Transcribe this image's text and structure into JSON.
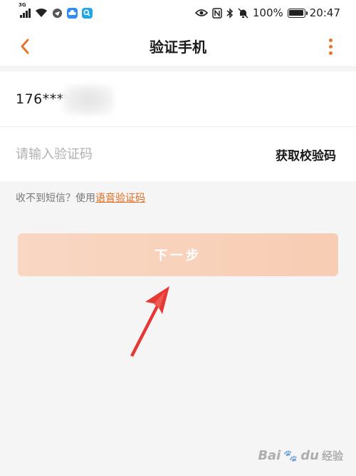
{
  "status_bar": {
    "network": "3G",
    "battery": "100%",
    "time": "20:47"
  },
  "header": {
    "title": "验证手机"
  },
  "form": {
    "phone_number": "176****",
    "code_placeholder": "请输入验证码",
    "get_code_label": "获取校验码"
  },
  "hint": {
    "text": "收不到短信？使用",
    "link": "语音验证码"
  },
  "next_button": {
    "label": "下一步"
  },
  "watermark": {
    "brand": "Bai",
    "paw": "du",
    "suffix": "经验"
  },
  "colors": {
    "accent": "#e8742c",
    "link": "#e26b1e",
    "button_disabled": "#f8d2bb",
    "annotation_arrow": "#e53935"
  }
}
